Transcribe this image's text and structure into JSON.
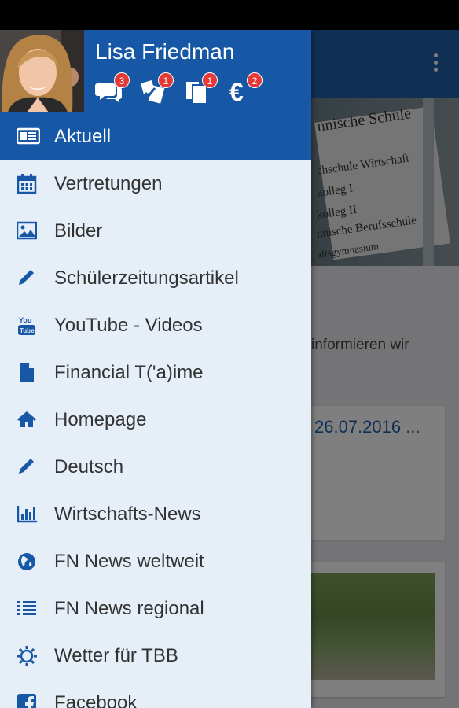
{
  "app": {
    "hero_sign_lines": [
      "nnische Schule",
      "chschule Wirtschaft",
      "kolleg I",
      "kolleg II",
      "nnische Berufsschule",
      "aftsgymnasium"
    ],
    "intro_text": "informieren wir",
    "card_date": "26.07.2016 ..."
  },
  "user": {
    "name": "Lisa Friedman",
    "avatar_icon": "user-avatar"
  },
  "header_icons": [
    {
      "icon": "chat-icon",
      "badge": "3"
    },
    {
      "icon": "poll-icon",
      "badge": "1"
    },
    {
      "icon": "documents-icon",
      "badge": "1"
    },
    {
      "icon": "euro-icon",
      "badge": "2"
    }
  ],
  "menu": [
    {
      "label": "Aktuell",
      "icon": "newspaper-icon",
      "active": true
    },
    {
      "label": "Vertretungen",
      "icon": "calendar-icon"
    },
    {
      "label": "Bilder",
      "icon": "image-icon"
    },
    {
      "label": "Schülerzeitungsartikel",
      "icon": "pencil-icon"
    },
    {
      "label": "YouTube - Videos",
      "icon": "youtube-icon"
    },
    {
      "label": "Financial T('a)ime",
      "icon": "file-icon"
    },
    {
      "label": "Homepage",
      "icon": "home-icon"
    },
    {
      "label": "Deutsch",
      "icon": "pencil-icon"
    },
    {
      "label": "Wirtschafts-News",
      "icon": "bar-chart-icon"
    },
    {
      "label": "FN News weltweit",
      "icon": "globe-icon"
    },
    {
      "label": "FN News regional",
      "icon": "list-icon"
    },
    {
      "label": "Wetter für TBB",
      "icon": "sun-icon"
    },
    {
      "label": "Facebook",
      "icon": "facebook-icon"
    }
  ],
  "colors": {
    "brand_blue": "#1758a6",
    "drawer_bg": "#e6eef8",
    "badge_red": "#e53935",
    "icon_blue": "#1758a6"
  }
}
